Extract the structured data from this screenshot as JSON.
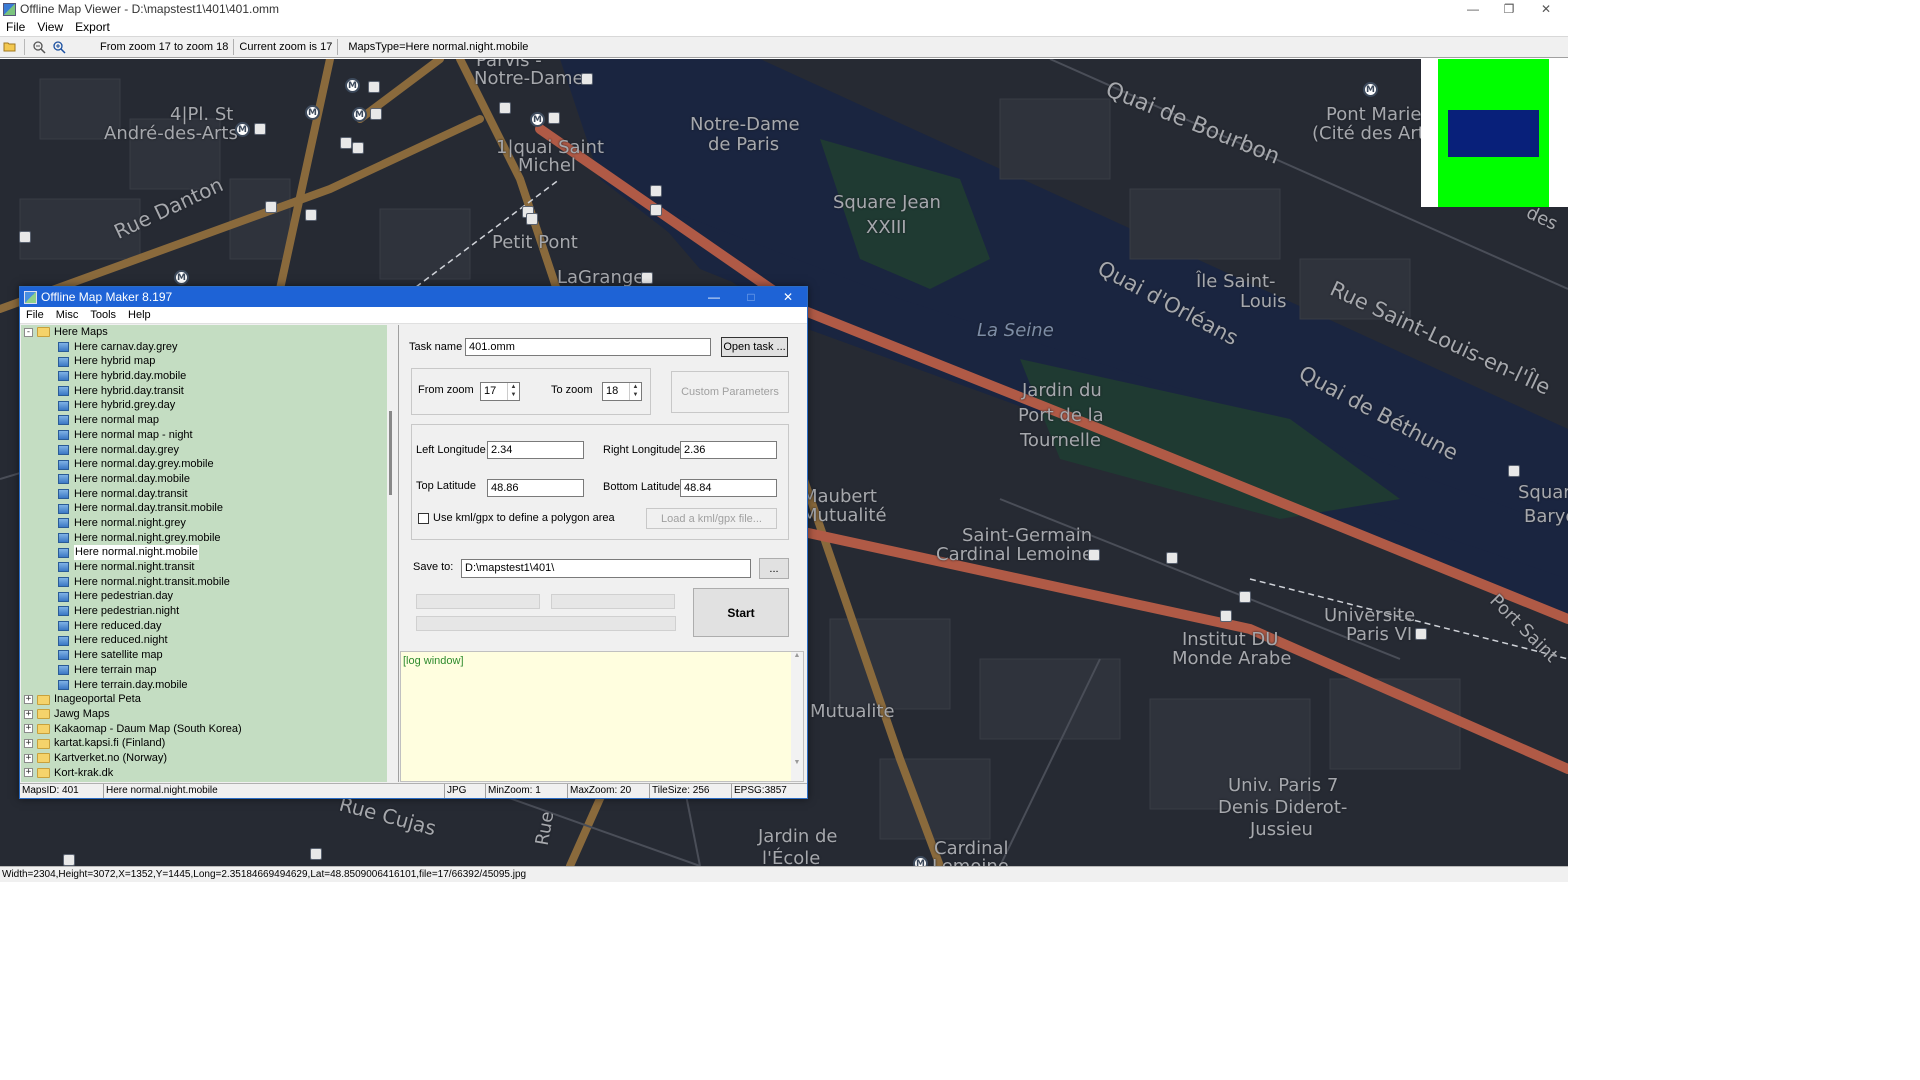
{
  "window": {
    "title": "Offline Map Viewer - D:\\mapstest1\\401\\401.omm",
    "menu": [
      "File",
      "View",
      "Export"
    ],
    "toolbar": {
      "zoom_range": "From zoom 17 to zoom 18",
      "current_zoom": "Current zoom is 17",
      "maps_type": "MapsType=Here normal.night.mobile"
    },
    "status": "Width=2304,Height=3072,X=1352,Y=1445,Long=2.35184669494629,Lat=48.8509006416101,file=17/66392/45095.jpg"
  },
  "map": {
    "labels": [
      "Parvis -",
      "Notre-Dame",
      "4|Pl. St",
      "André-des-Arts",
      "Notre-Dame",
      "de Paris",
      "1|quai Saint",
      "Michel",
      "Rue Danton",
      "Petit Pont",
      "LaGrange",
      "Square Jean",
      "XXIII",
      "Quai de Bourbon",
      "Pont Marie",
      "(Cité des Arts)",
      "Île Saint-",
      "Louis",
      "Quai d'Orléans",
      "Rue Saint-Louis-en-l'Île",
      "Quai de Béthune",
      "La Seine",
      "Jardin du",
      "Port de la",
      "Tournelle",
      "Maubert",
      "Mutualité",
      "Saint-Germain",
      "Cardinal Lemoine",
      "Institut DU",
      "Monde Arabe",
      "Universite",
      "Paris VI",
      "Port Saint",
      "Univ. Paris 7",
      "Denis Diderot-",
      "Jussieu",
      "Rue Cujas",
      "Jardin de",
      "l'École",
      "Cardinal",
      "Lemoine",
      "Square",
      "Barye",
      "des",
      "Rue",
      "Mutualite"
    ],
    "metro_symbol": "M"
  },
  "dialog": {
    "title": "Offline Map Maker 8.197",
    "menu": [
      "File",
      "Misc",
      "Tools",
      "Help"
    ],
    "tree": {
      "expanded_root": "Here Maps",
      "children": [
        "Here carnav.day.grey",
        "Here hybrid map",
        "Here hybrid.day.mobile",
        "Here hybrid.day.transit",
        "Here hybrid.grey.day",
        "Here normal map",
        "Here normal map - night",
        "Here normal.day.grey",
        "Here normal.day.grey.mobile",
        "Here normal.day.mobile",
        "Here normal.day.transit",
        "Here normal.day.transit.mobile",
        "Here normal.night.grey",
        "Here normal.night.grey.mobile",
        "Here normal.night.mobile",
        "Here normal.night.transit",
        "Here normal.night.transit.mobile",
        "Here pedestrian.day",
        "Here pedestrian.night",
        "Here reduced.day",
        "Here reduced.night",
        "Here satellite map",
        "Here terrain map",
        "Here terrain.day.mobile"
      ],
      "selected": "Here normal.night.mobile",
      "collapsed_roots": [
        "Inageoportal Peta",
        "Jawg Maps",
        "Kakaomap - Daum Map (South Korea)",
        "kartat.kapsi.fi (Finland)",
        "Kartverket.no (Norway)",
        "Kort-krak.dk"
      ]
    },
    "form": {
      "task_name_label": "Task name",
      "task_name_value": "401.omm",
      "open_task_button": "Open task ...",
      "from_zoom_label": "From zoom",
      "from_zoom_value": "17",
      "to_zoom_label": "To zoom",
      "to_zoom_value": "18",
      "custom_params_button": "Custom Parameters",
      "left_lon_label": "Left Longitude",
      "left_lon_value": "2.34",
      "right_lon_label": "Right Longitude",
      "right_lon_value": "2.36",
      "top_lat_label": "Top Latitude",
      "top_lat_value": "48.86",
      "bottom_lat_label": "Bottom Latitude",
      "bottom_lat_value": "48.84",
      "kml_checkbox_label": "Use kml/gpx to define a polygon area",
      "kml_checked": false,
      "load_kml_button": "Load a kml/gpx file...",
      "save_to_label": "Save to:",
      "save_to_value": "D:\\mapstest1\\401\\",
      "browse_button": "...",
      "start_button": "Start",
      "log_text": "[log window]"
    },
    "status": {
      "maps_id": "MapsID: 401",
      "maps_name": "Here normal.night.mobile",
      "format": "JPG",
      "min_zoom": "MinZoom: 1",
      "max_zoom": "MaxZoom: 20",
      "tile_size": "TileSize: 256",
      "epsg": "EPSG:3857"
    }
  },
  "colors": {
    "map_background": "#262a33",
    "river": "#1a2540",
    "park": "#1f3a32",
    "main_road": "#b05a46",
    "secondary_road": "#8a6a3c",
    "tree_background": "#c4ddc2",
    "dialog_titlebar": "#1e63d6",
    "log_background": "#fffedf",
    "minimap_green": "#00ff00",
    "minimap_blue": "#08207a"
  }
}
